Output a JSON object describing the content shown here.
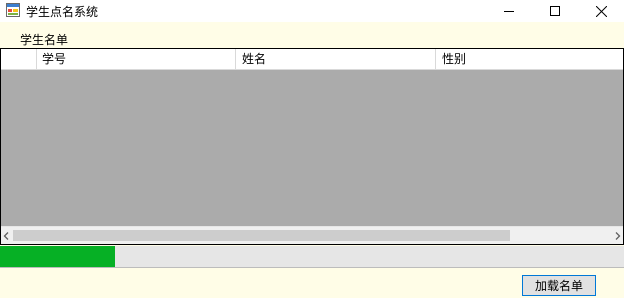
{
  "window": {
    "title": "学生点名系统"
  },
  "icons": {
    "app": "app-form-icon",
    "minimize": "minimize-icon",
    "maximize": "maximize-icon",
    "close": "close-icon",
    "scroll_left": "chevron-left-icon",
    "scroll_right": "chevron-right-icon"
  },
  "section": {
    "label": "学生名单"
  },
  "grid": {
    "columns": [
      "学号",
      "姓名",
      "性别"
    ],
    "rows": []
  },
  "progress": {
    "fraction": 0.185,
    "color": "#06b025"
  },
  "actions": {
    "load_label": "加载名单"
  },
  "colors": {
    "background": "#fffde7",
    "grid_empty": "#ababab",
    "button_border": "#0078d7"
  }
}
